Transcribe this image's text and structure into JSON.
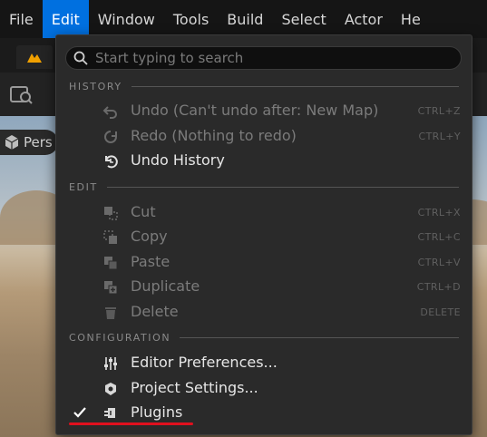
{
  "menubar": {
    "items": [
      {
        "label": "File",
        "active": false
      },
      {
        "label": "Edit",
        "active": true
      },
      {
        "label": "Window",
        "active": false
      },
      {
        "label": "Tools",
        "active": false
      },
      {
        "label": "Build",
        "active": false
      },
      {
        "label": "Select",
        "active": false
      },
      {
        "label": "Actor",
        "active": false
      },
      {
        "label": "He",
        "active": false
      }
    ]
  },
  "viewport": {
    "badge_label": "Pers"
  },
  "menu": {
    "search": {
      "placeholder": "Start typing to search"
    },
    "sections": {
      "history": "HISTORY",
      "edit": "EDIT",
      "configuration": "CONFIGURATION"
    },
    "history_items": [
      {
        "label": "Undo (Can't undo after: New Map)",
        "shortcut": "CTRL+Z",
        "icon": "undo-icon",
        "enabled": false
      },
      {
        "label": "Redo (Nothing to redo)",
        "shortcut": "CTRL+Y",
        "icon": "redo-icon",
        "enabled": false
      },
      {
        "label": "Undo History",
        "shortcut": "",
        "icon": "undo-history-icon",
        "enabled": true
      }
    ],
    "edit_items": [
      {
        "label": "Cut",
        "shortcut": "CTRL+X",
        "icon": "cut-icon",
        "enabled": false
      },
      {
        "label": "Copy",
        "shortcut": "CTRL+C",
        "icon": "copy-icon",
        "enabled": false
      },
      {
        "label": "Paste",
        "shortcut": "CTRL+V",
        "icon": "paste-icon",
        "enabled": false
      },
      {
        "label": "Duplicate",
        "shortcut": "CTRL+D",
        "icon": "duplicate-icon",
        "enabled": false
      },
      {
        "label": "Delete",
        "shortcut": "DELETE",
        "icon": "trash-icon",
        "enabled": false
      }
    ],
    "config_items": [
      {
        "label": "Editor Preferences...",
        "icon": "sliders-icon",
        "checked": false
      },
      {
        "label": "Project Settings...",
        "icon": "project-settings-icon",
        "checked": false
      },
      {
        "label": "Plugins",
        "icon": "plugin-icon",
        "checked": true
      }
    ]
  },
  "colors": {
    "menubar_active": "#0070e0",
    "menu_bg": "#2a2a2a",
    "highlight_underline": "#e0101e"
  }
}
